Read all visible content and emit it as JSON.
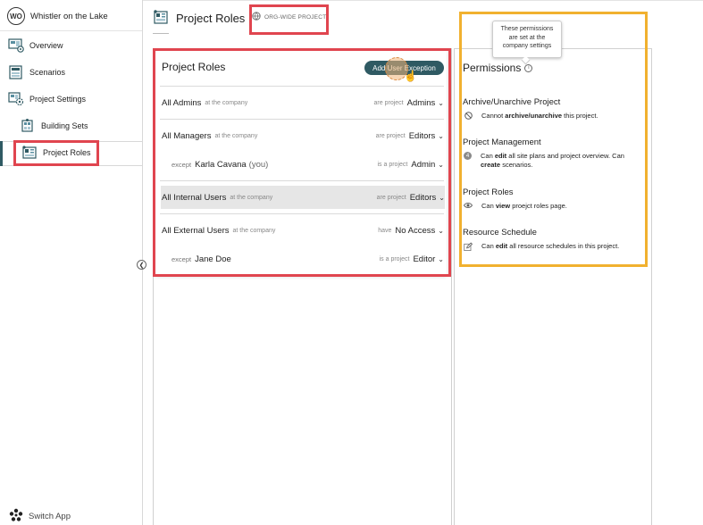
{
  "org": {
    "initials": "WO",
    "name": "Whistler on the Lake"
  },
  "sidebar": {
    "items": [
      {
        "label": "Overview",
        "icon": "overview-icon"
      },
      {
        "label": "Scenarios",
        "icon": "scenarios-icon"
      },
      {
        "label": "Project Settings",
        "icon": "project-settings-icon"
      },
      {
        "label": "Building Sets",
        "icon": "building-sets-icon"
      },
      {
        "label": "Project Roles",
        "icon": "project-roles-icon",
        "active": true
      }
    ],
    "switch_app": "Switch App"
  },
  "header": {
    "title": "Project Roles",
    "badge": "ORG-WIDE PROJECT"
  },
  "roles": {
    "title": "Project Roles",
    "add_button": "Add User Exception",
    "rows": [
      {
        "who": "All Admins",
        "context": "at the company",
        "verb": "are project",
        "role": "Admins"
      },
      {
        "who": "All Managers",
        "context": "at the company",
        "verb": "are project",
        "role": "Editors"
      },
      {
        "prefix": "except",
        "who": "Karla Cavana",
        "note": "(you)",
        "verb": "is a project",
        "role": "Admin"
      },
      {
        "who": "All Internal Users",
        "context": "at the company",
        "verb": "are project",
        "role": "Editors"
      },
      {
        "who": "All External Users",
        "context": "at the company",
        "verb": "have",
        "role": "No Access"
      },
      {
        "prefix": "except",
        "who": "Jane Doe",
        "verb": "is a project",
        "role": "Editor"
      }
    ]
  },
  "permissions": {
    "title": "Permissions",
    "tooltip": [
      "These permissions",
      "are set at the",
      "company settings"
    ],
    "sections": [
      {
        "title": "Archive/Unarchive Project",
        "icon": "no-entry-icon",
        "parts": [
          "Cannot ",
          "archive/unarchive",
          " this project."
        ]
      },
      {
        "title": "Project Management",
        "icon": "count-badge-icon",
        "badge": "4",
        "parts": [
          "Can ",
          "edit",
          " all site plans and project overview. Can ",
          "create",
          " scenarios."
        ]
      },
      {
        "title": "Project Roles",
        "icon": "eye-icon",
        "parts": [
          "Can ",
          "view",
          " proejct roles page."
        ]
      },
      {
        "title": "Resource Schedule",
        "icon": "edit-icon",
        "parts": [
          "Can ",
          "edit",
          " all resource schedules in this project."
        ]
      }
    ]
  }
}
